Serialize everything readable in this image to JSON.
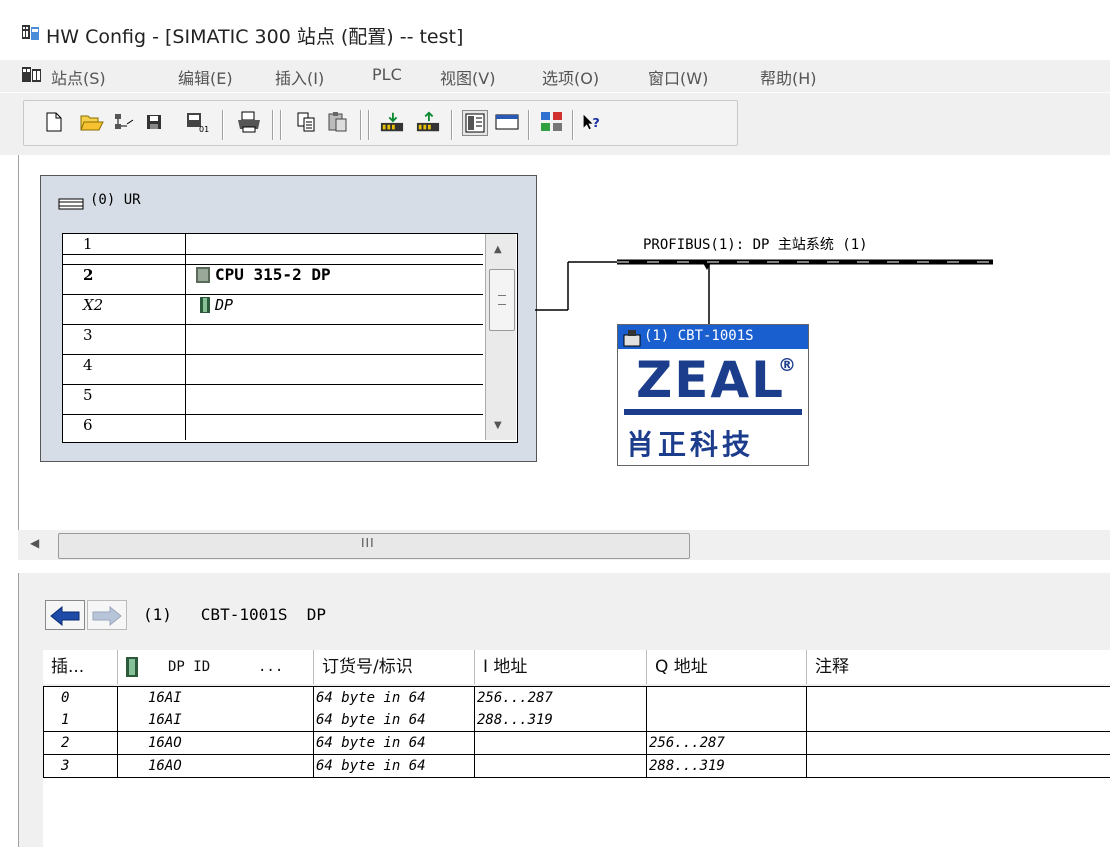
{
  "window": {
    "title": "HW Config - [SIMATIC 300 站点 (配置) -- test]",
    "app_icon": "hw-config-icon"
  },
  "menu": {
    "items": [
      "站点(S)",
      "编辑(E)",
      "插入(I)",
      "PLC",
      "视图(V)",
      "选项(O)",
      "窗口(W)",
      "帮助(H)"
    ]
  },
  "toolbar": {
    "buttons": [
      "new-icon",
      "open-icon",
      "network-icon",
      "save-icon",
      "compile-icon",
      "print-icon",
      "copy-icon",
      "paste-icon",
      "download-icon",
      "upload-icon",
      "catalog-icon",
      "view-icon",
      "netpro-icon",
      "help-icon"
    ]
  },
  "rack": {
    "title": "(0) UR",
    "rows": [
      {
        "slot": "1",
        "module": ""
      },
      {
        "slot": "2",
        "module": "CPU 315-2 DP"
      },
      {
        "slot": "X2",
        "module": "DP"
      },
      {
        "slot": "3",
        "module": ""
      },
      {
        "slot": "4",
        "module": ""
      },
      {
        "slot": "5",
        "module": ""
      },
      {
        "slot": "6",
        "module": ""
      }
    ]
  },
  "network": {
    "bus_label": "PROFIBUS(1): DP 主站系统 (1)",
    "device_label": "(1) CBT-1001S",
    "logo_text": "ZEAL",
    "logo_registered": "®",
    "logo_cn": "肖正科技"
  },
  "hscroll": {
    "thumb_glyph": "III"
  },
  "detail": {
    "title": "(1)   CBT-1001S  DP",
    "columns": [
      "插...",
      "DP ID",
      "...",
      "订货号/标识",
      "I 地址",
      "Q 地址",
      "注释"
    ],
    "rows": [
      {
        "slot": "0",
        "dpid": "16AI",
        "order": "64 byte in 64",
        "i": "256...287",
        "q": "",
        "comment": ""
      },
      {
        "slot": "1",
        "dpid": "16AI",
        "order": "64 byte in 64",
        "i": "288...319",
        "q": "",
        "comment": ""
      },
      {
        "slot": "2",
        "dpid": "16AO",
        "order": "64 byte in 64",
        "i": "",
        "q": "256...287",
        "comment": ""
      },
      {
        "slot": "3",
        "dpid": "16AO",
        "order": "64 byte in 64",
        "i": "",
        "q": "288...319",
        "comment": ""
      }
    ]
  },
  "colors": {
    "bus": "#000000",
    "rack_bg": "#d6dde6",
    "logo_blue": "#1c3d8c",
    "device_header": "#1a5fd0"
  }
}
